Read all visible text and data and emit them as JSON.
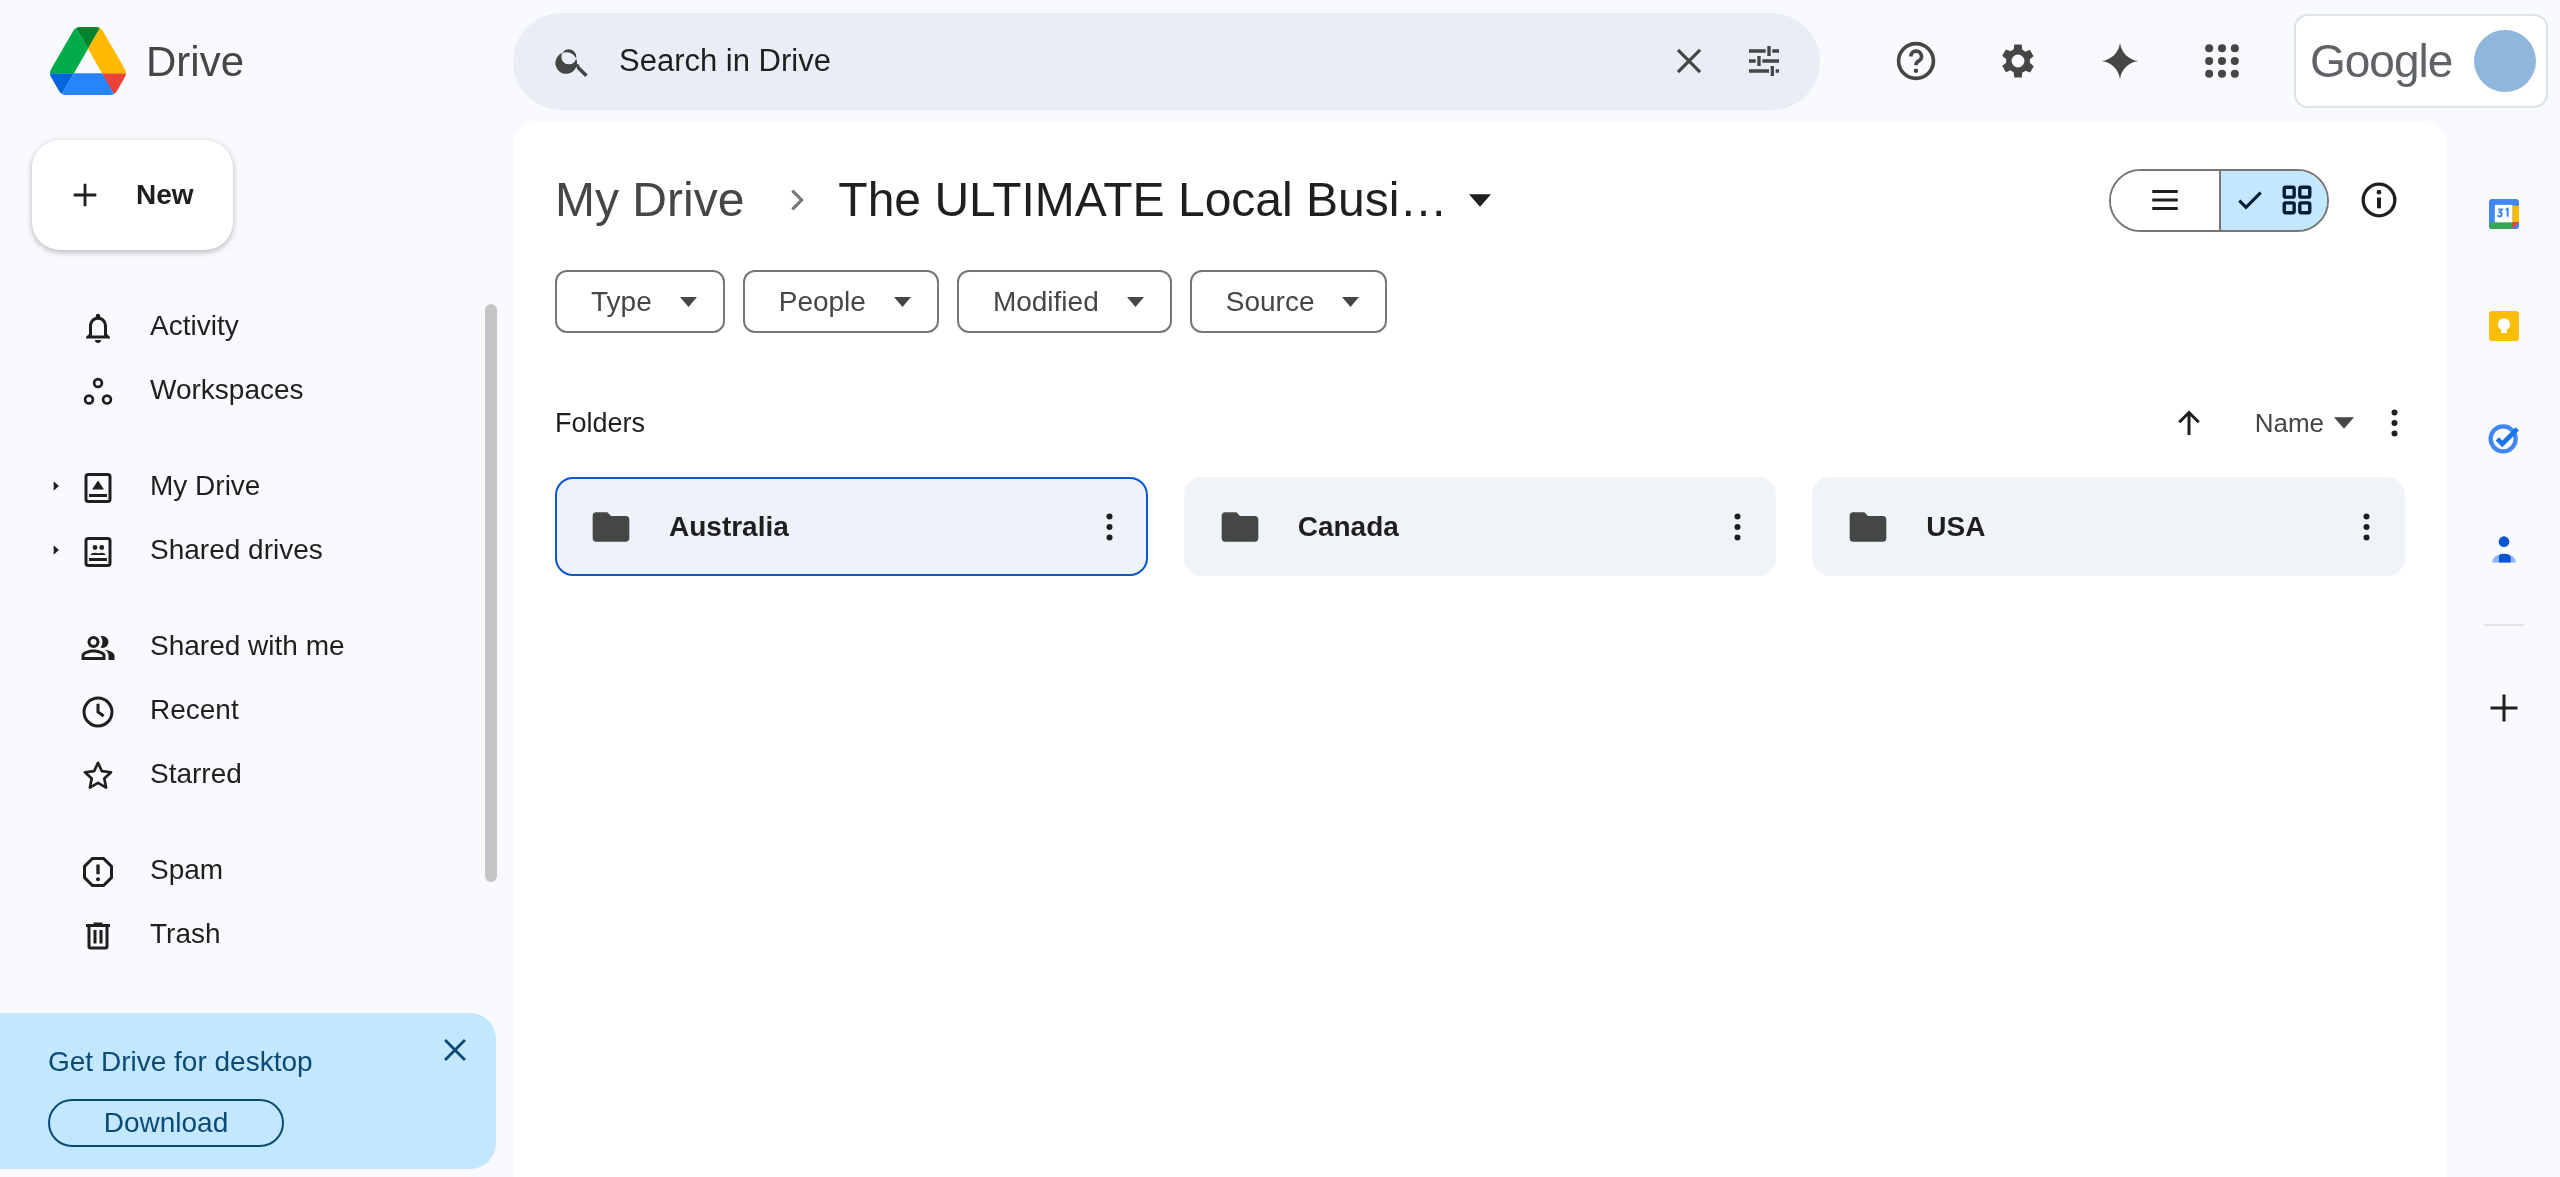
{
  "app": {
    "name": "Drive"
  },
  "search": {
    "placeholder": "Search in Drive"
  },
  "account": {
    "brand": "Google"
  },
  "new_button": {
    "label": "New"
  },
  "sidebar": {
    "sections": [
      {
        "items": [
          {
            "label": "Activity"
          },
          {
            "label": "Workspaces"
          }
        ]
      },
      {
        "items": [
          {
            "label": "My Drive",
            "expanded": false
          },
          {
            "label": "Shared drives",
            "expanded": false
          }
        ]
      },
      {
        "items": [
          {
            "label": "Shared with me"
          },
          {
            "label": "Recent"
          },
          {
            "label": "Starred"
          }
        ]
      },
      {
        "items": [
          {
            "label": "Spam"
          },
          {
            "label": "Trash"
          }
        ]
      }
    ]
  },
  "promo": {
    "title": "Get Drive for desktop",
    "button": "Download"
  },
  "breadcrumb": {
    "parent": "My Drive",
    "current": "The ULTIMATE Local Busi…"
  },
  "view_toggle": [
    {
      "kind": "list",
      "selected": false
    },
    {
      "kind": "grid",
      "selected": true
    }
  ],
  "filters": [
    {
      "label": "Type"
    },
    {
      "label": "People"
    },
    {
      "label": "Modified"
    },
    {
      "label": "Source"
    }
  ],
  "folders_section": {
    "title": "Folders",
    "sort_label": "Name"
  },
  "folders": [
    {
      "name": "Australia",
      "selected": true
    },
    {
      "name": "Canada",
      "selected": false
    },
    {
      "name": "USA",
      "selected": false
    }
  ]
}
